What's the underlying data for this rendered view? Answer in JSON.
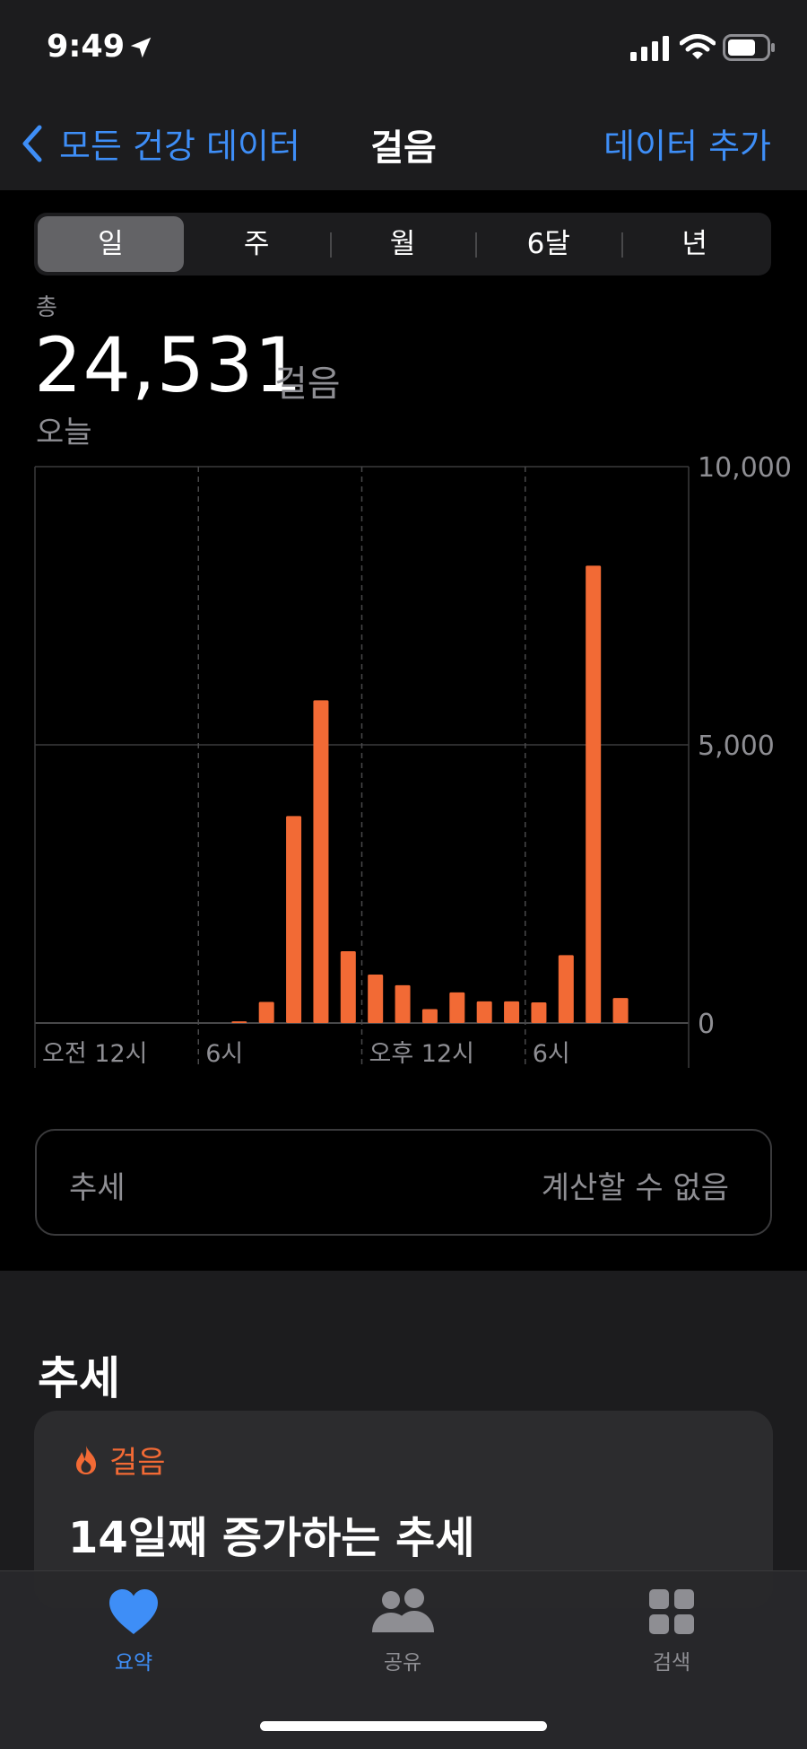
{
  "status_bar": {
    "time": "9:49",
    "icons": [
      "location-arrow-icon",
      "cellular-signal-icon",
      "wifi-icon",
      "battery-icon"
    ]
  },
  "nav": {
    "back_label": "모든 건강 데이터",
    "title": "걸음",
    "action_label": "데이터 추가"
  },
  "segments": {
    "items": [
      "일",
      "주",
      "월",
      "6달",
      "년"
    ],
    "selected": "일"
  },
  "summary": {
    "label": "총",
    "value": "24,531",
    "unit": "걸음",
    "date": "오늘"
  },
  "chart_data": {
    "type": "bar",
    "title": "",
    "xlabel": "",
    "ylabel": "",
    "x_tick_labels": [
      "오전 12시",
      "6시",
      "오후 12시",
      "6시"
    ],
    "y_tick_labels": [
      "10,000",
      "5,000",
      "0"
    ],
    "ylim": [
      0,
      10000
    ],
    "x_unit": "hour of day",
    "grid": true,
    "bar_color": "#f26a35",
    "data": [
      {
        "hour": 7,
        "steps": 30
      },
      {
        "hour": 8,
        "steps": 380
      },
      {
        "hour": 9,
        "steps": 3720
      },
      {
        "hour": 10,
        "steps": 5800
      },
      {
        "hour": 11,
        "steps": 1290
      },
      {
        "hour": 12,
        "steps": 870
      },
      {
        "hour": 13,
        "steps": 680
      },
      {
        "hour": 14,
        "steps": 250
      },
      {
        "hour": 15,
        "steps": 550
      },
      {
        "hour": 16,
        "steps": 390
      },
      {
        "hour": 17,
        "steps": 390
      },
      {
        "hour": 18,
        "steps": 370
      },
      {
        "hour": 19,
        "steps": 1220
      },
      {
        "hour": 20,
        "steps": 8220
      },
      {
        "hour": 21,
        "steps": 450
      }
    ]
  },
  "trend_row": {
    "label": "추세",
    "value": "계산할 수 없음"
  },
  "trends_section": {
    "title": "추세",
    "card_category": "걸음",
    "card_text": "14일째 증가하는 추세"
  },
  "tabbar": {
    "items": [
      {
        "label": "요약",
        "icon": "heart-icon",
        "active": true
      },
      {
        "label": "공유",
        "icon": "people-icon",
        "active": false
      },
      {
        "label": "검색",
        "icon": "grid-icon",
        "active": false
      }
    ]
  },
  "colors": {
    "accent": "#3e8ef7",
    "bars": "#f26a35",
    "background": "#000000",
    "panel": "#1c1c1e"
  }
}
